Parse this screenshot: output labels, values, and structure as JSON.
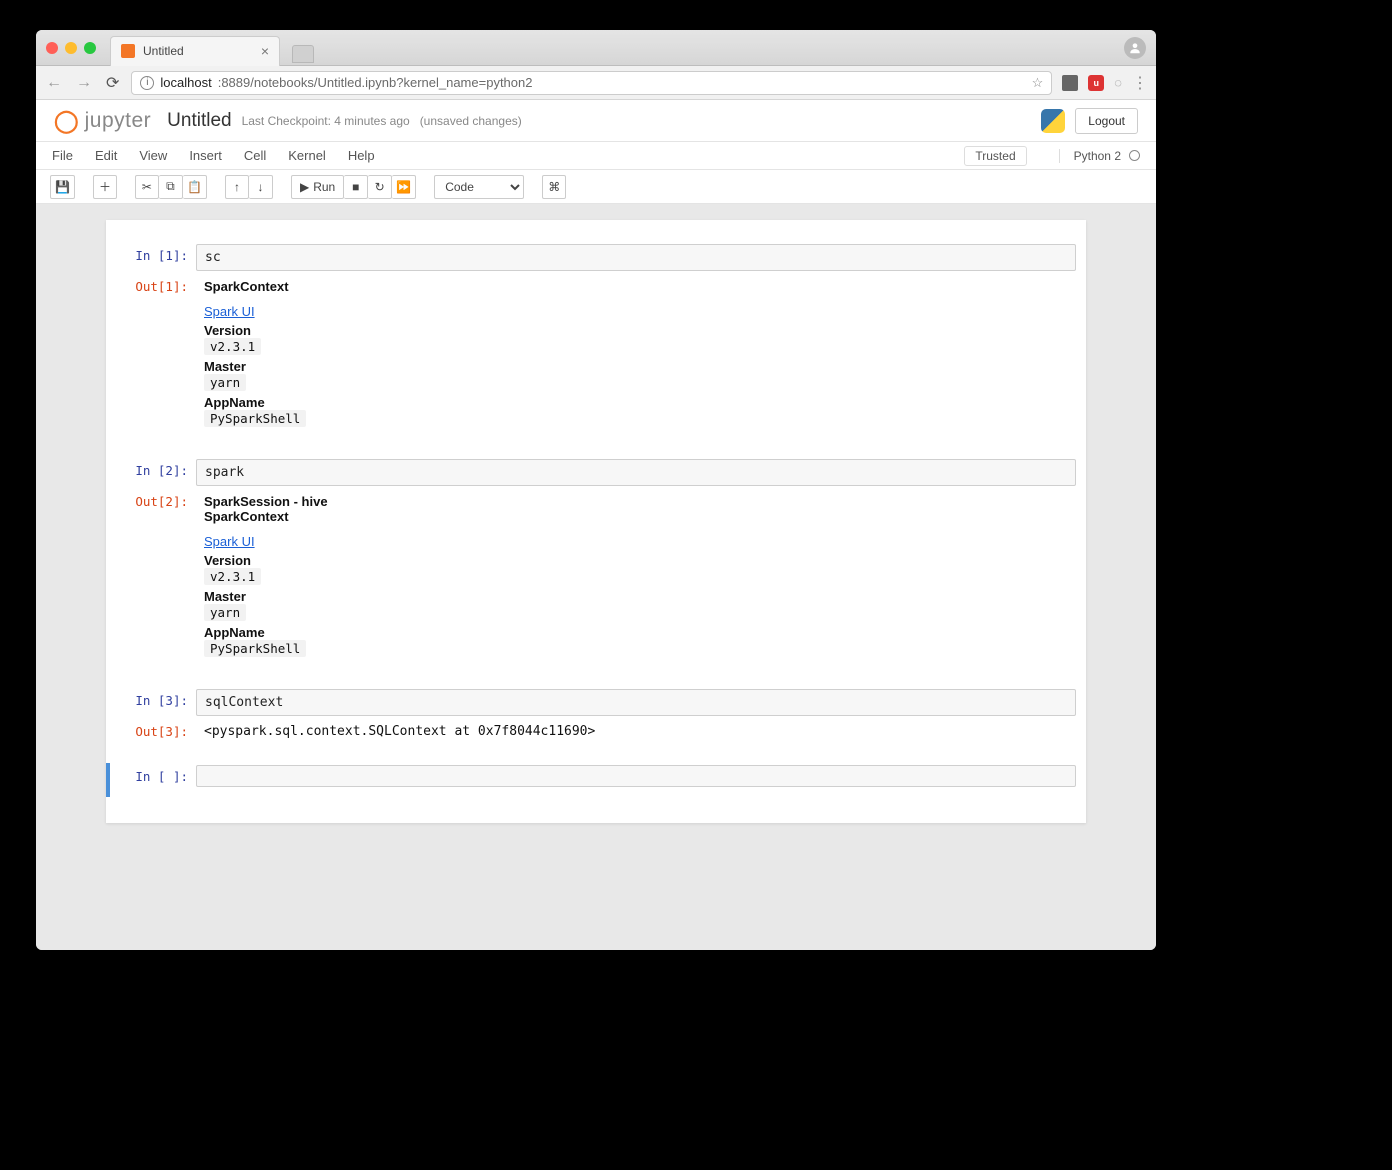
{
  "chrome": {
    "tab_title": "Untitled",
    "url_host": "localhost",
    "url_path": ":8889/notebooks/Untitled.ipynb?kernel_name=python2"
  },
  "header": {
    "brand": "jupyter",
    "title": "Untitled",
    "checkpoint": "Last Checkpoint: 4 minutes ago",
    "unsaved": "(unsaved changes)",
    "logout": "Logout"
  },
  "menu": {
    "file": "File",
    "edit": "Edit",
    "view": "View",
    "insert": "Insert",
    "cell": "Cell",
    "kernel": "Kernel",
    "help": "Help",
    "trusted": "Trusted",
    "kernel_name": "Python 2"
  },
  "toolbar": {
    "run": "Run",
    "cell_type": "Code"
  },
  "cells": [
    {
      "in_prompt": "In [1]:",
      "code": "sc",
      "out_prompt": "Out[1]:",
      "out": {
        "heading": "SparkContext",
        "link": "Spark UI",
        "kv": [
          {
            "label": "Version",
            "value": "v2.3.1"
          },
          {
            "label": "Master",
            "value": "yarn"
          },
          {
            "label": "AppName",
            "value": "PySparkShell"
          }
        ]
      }
    },
    {
      "in_prompt": "In [2]:",
      "code": "spark",
      "out_prompt": "Out[2]:",
      "out": {
        "heading_a": "SparkSession - hive",
        "heading_b": "SparkContext",
        "link": "Spark UI",
        "kv": [
          {
            "label": "Version",
            "value": "v2.3.1"
          },
          {
            "label": "Master",
            "value": "yarn"
          },
          {
            "label": "AppName",
            "value": "PySparkShell"
          }
        ]
      }
    },
    {
      "in_prompt": "In [3]:",
      "code": "sqlContext",
      "out_prompt": "Out[3]:",
      "out_text": "<pyspark.sql.context.SQLContext at 0x7f8044c11690>"
    },
    {
      "in_prompt": "In [ ]:",
      "code": ""
    }
  ]
}
